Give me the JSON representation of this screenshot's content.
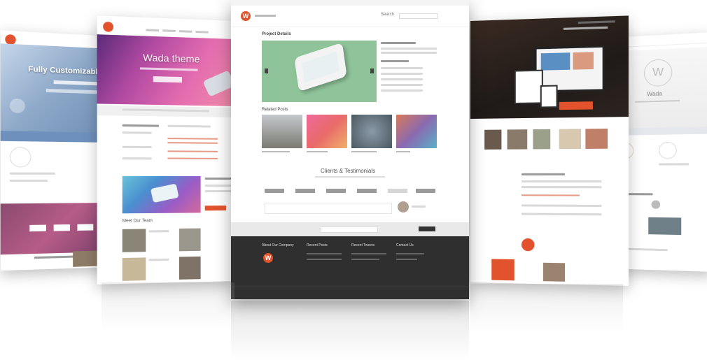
{
  "colors": {
    "accent": "#e2532d",
    "footer": "#2f2f2f",
    "green": "#8fc49a"
  },
  "pages": {
    "p1": {
      "hero_title": "Fully Customizable"
    },
    "p2": {
      "hero_title": "Wada theme",
      "tagline": "Wada",
      "team_title": "Meet Our Team"
    },
    "center": {
      "nav_search": "Search",
      "section_title": "Project Details",
      "related_title": "Related Posts",
      "clients_title": "Clients & Testimonials",
      "footer_col1": "About Our Company",
      "footer_col2": "Recent Posts",
      "footer_col3": "Recent Tweets",
      "footer_col4": "Contact Us"
    },
    "p5": {
      "brand": "Wada"
    }
  }
}
